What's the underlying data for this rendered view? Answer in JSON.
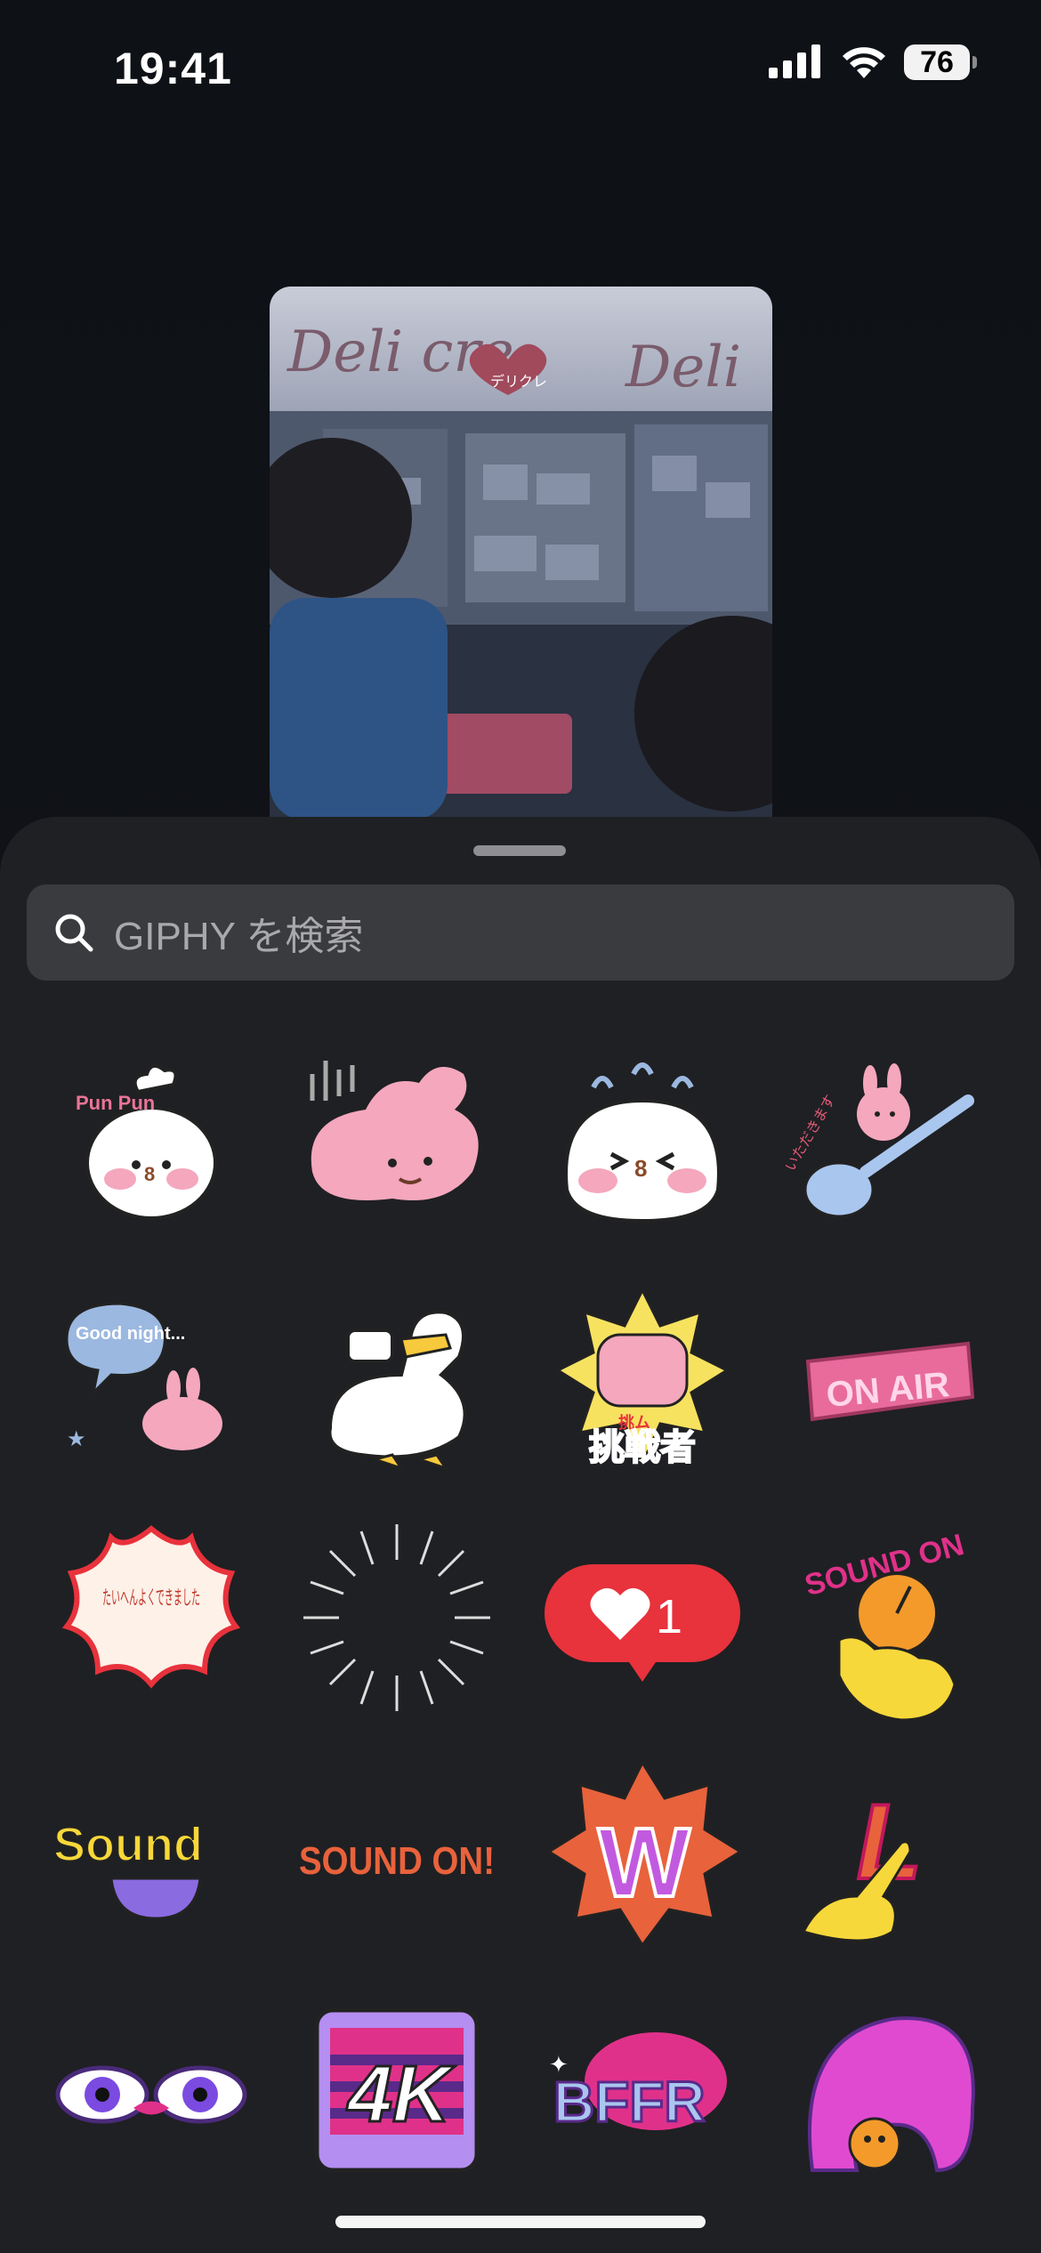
{
  "status_bar": {
    "time": "19:41",
    "battery": "76",
    "icons": [
      "cellular-signal-icon",
      "wifi-icon",
      "battery-icon"
    ]
  },
  "preview": {
    "sign_left": "Deli cre",
    "sign_right": "Deli",
    "badge": "デリクレ"
  },
  "search": {
    "placeholder": "GIPHY を検索"
  },
  "stickers": {
    "r1c1_text": "Pun Pun",
    "r1c4_text": "いただきます",
    "r2c1_text": "Good night...",
    "r2c3_top": "挑ム",
    "r2c3_text": "挑戦者",
    "r2c4_text": "ON AIR",
    "r3c1_text": "たいへんよくできました",
    "r3c3_count": "1",
    "r3c4_text": "SOUND ON",
    "r4c1_text": "Sound",
    "r4c2_text": "SOUND ON!",
    "r4c3_text": "W",
    "r4c4_text": "L",
    "r5c2_text": "4K",
    "r5c3_text": "BFFR"
  },
  "colors": {
    "sheet_bg": "#1f2023",
    "search_bg": "#3a3b3e",
    "accent_red": "#e8323c",
    "pink": "#f4a7bd"
  }
}
